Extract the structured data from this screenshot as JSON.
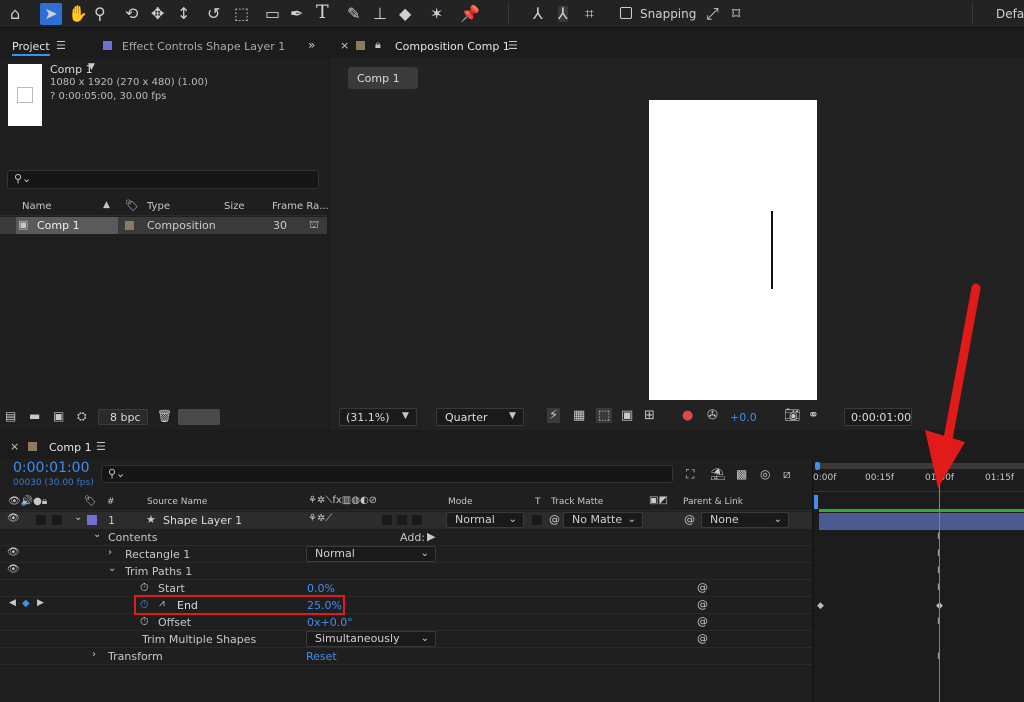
{
  "toolbar": {
    "snapping_label": "Snapping",
    "workspace_label": "Defau"
  },
  "project_panel": {
    "tab_label": "Project",
    "effect_controls_tab": "Effect Controls Shape Layer 1",
    "preview_name": "Comp 1",
    "preview_dims": "1080 x 1920  (270 x 480) (1.00)",
    "preview_duration": "? 0:00:05:00, 30.00 fps",
    "columns": [
      "Name",
      "Type",
      "Size",
      "Frame Ra..."
    ],
    "items": [
      {
        "name": "Comp 1",
        "type": "Composition",
        "size": "",
        "frame_rate": "30"
      }
    ],
    "bpc_label": "8 bpc"
  },
  "composition_panel": {
    "tab_label": "Composition Comp 1",
    "breadcrumb": "Comp 1",
    "zoom": "(31.1%)",
    "resolution": "Quarter",
    "exposure": "+0.0",
    "timecode": "0:00:01:00"
  },
  "timeline": {
    "tab_label": "Comp 1",
    "current_time": "0:00:01:00",
    "frame_info": "00030 (30.00 fps)",
    "columns": {
      "source_name": "Source Name",
      "mode": "Mode",
      "t": "T",
      "track_matte": "Track Matte",
      "parent_link": "Parent & Link"
    },
    "layer": {
      "index": "1",
      "name": "Shape Layer 1",
      "mode": "Normal",
      "track_matte": "No Matte",
      "parent": "None"
    },
    "contents_label": "Contents",
    "add_label": "Add:",
    "rectangle_label": "Rectangle 1",
    "rectangle_mode": "Normal",
    "trim_paths_label": "Trim Paths 1",
    "start_label": "Start",
    "start_value": "0.0%",
    "end_label": "End",
    "end_value": "25.0%",
    "offset_label": "Offset",
    "offset_value": "0x+0.0°",
    "trim_multiple_label": "Trim Multiple Shapes",
    "trim_multiple_value": "Simultaneously",
    "transform_label": "Transform",
    "transform_value": "Reset",
    "ruler": [
      "0:00f",
      "00:15f",
      "01:00f",
      "01:15f"
    ]
  },
  "colors": {
    "accent_blue": "#3e8ff0",
    "highlight_red": "#e11a1a",
    "layer_bar": "#4b5a8f",
    "label_purple": "#6f6fd6"
  }
}
